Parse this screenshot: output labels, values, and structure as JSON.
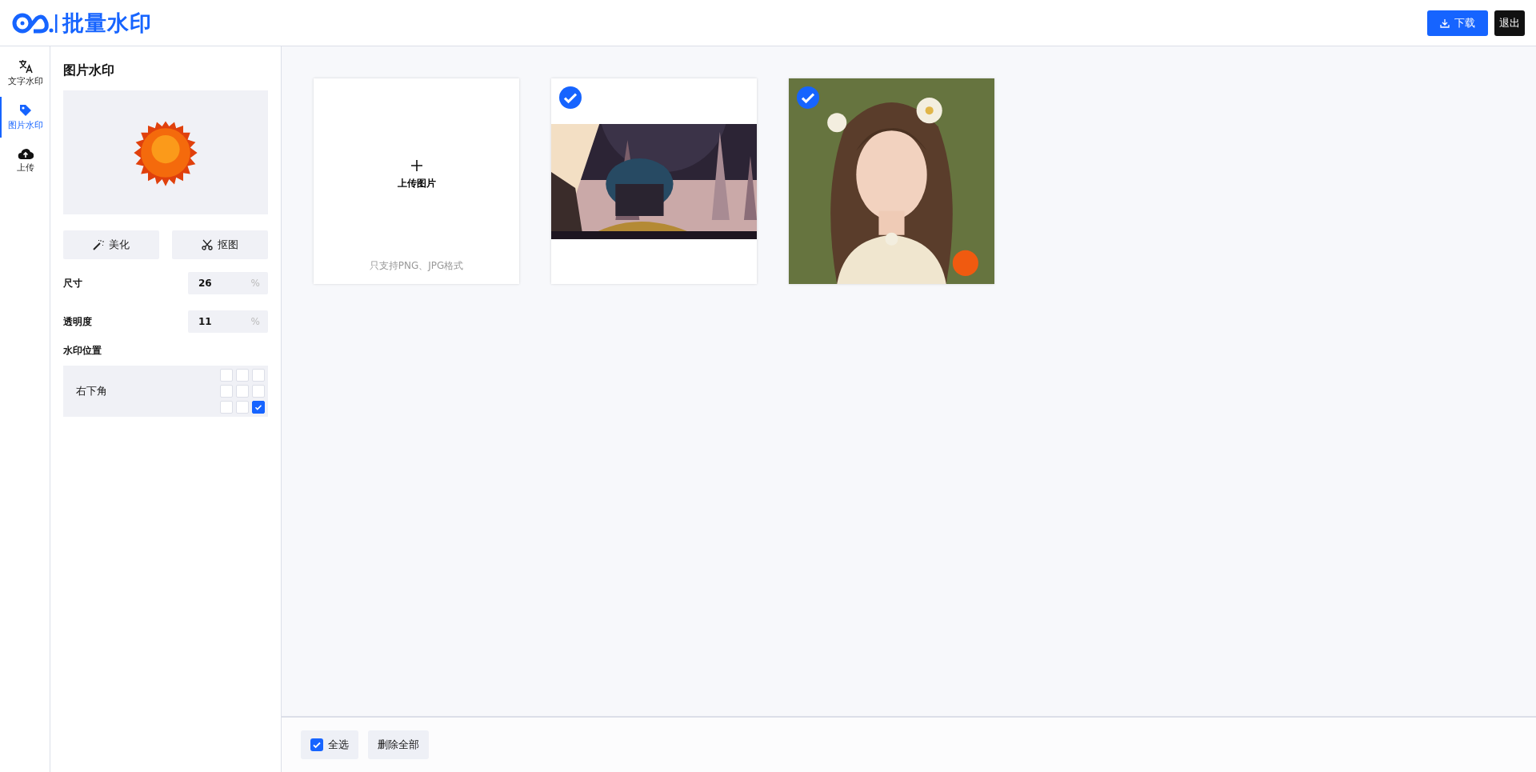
{
  "header": {
    "logo_text": "批量水印",
    "buttons": [
      {
        "kind": "download",
        "label": "下载"
      },
      {
        "kind": "logout",
        "label": "退出"
      }
    ]
  },
  "rail": [
    {
      "kind": "text",
      "label": "文字水印",
      "selected": false
    },
    {
      "label": "图片水印",
      "selected": true
    },
    {
      "kind": "upload",
      "label": "上传",
      "selected": false
    }
  ],
  "panel": {
    "title": "图片水印",
    "tools": [
      {
        "kind": "wand",
        "label": "美化"
      },
      {
        "kind": "scissors",
        "label": "抠图"
      }
    ],
    "fields": [
      {
        "label": "尺寸",
        "value": "26",
        "unit": "%"
      },
      {
        "label": "透明度",
        "value": "11",
        "unit": "%"
      }
    ],
    "position": {
      "label": "水印位置",
      "value": "右下角",
      "cells": [
        {
          "selected": false
        },
        {
          "selected": false
        },
        {
          "selected": false
        },
        {
          "selected": false
        },
        {
          "selected": false
        },
        {
          "selected": false
        },
        {
          "selected": false
        },
        {
          "selected": false
        },
        {
          "selected": true
        }
      ]
    }
  },
  "upload_card": {
    "label": "上传图片",
    "hint": "只支持PNG、JPG格式"
  },
  "images": [
    {
      "kind": "landscape",
      "checked": true
    },
    {
      "kind": "portrait",
      "checked": true
    }
  ],
  "footer": {
    "select_all": {
      "label": "全选",
      "checked": true
    },
    "delete_all": "删除全部"
  }
}
